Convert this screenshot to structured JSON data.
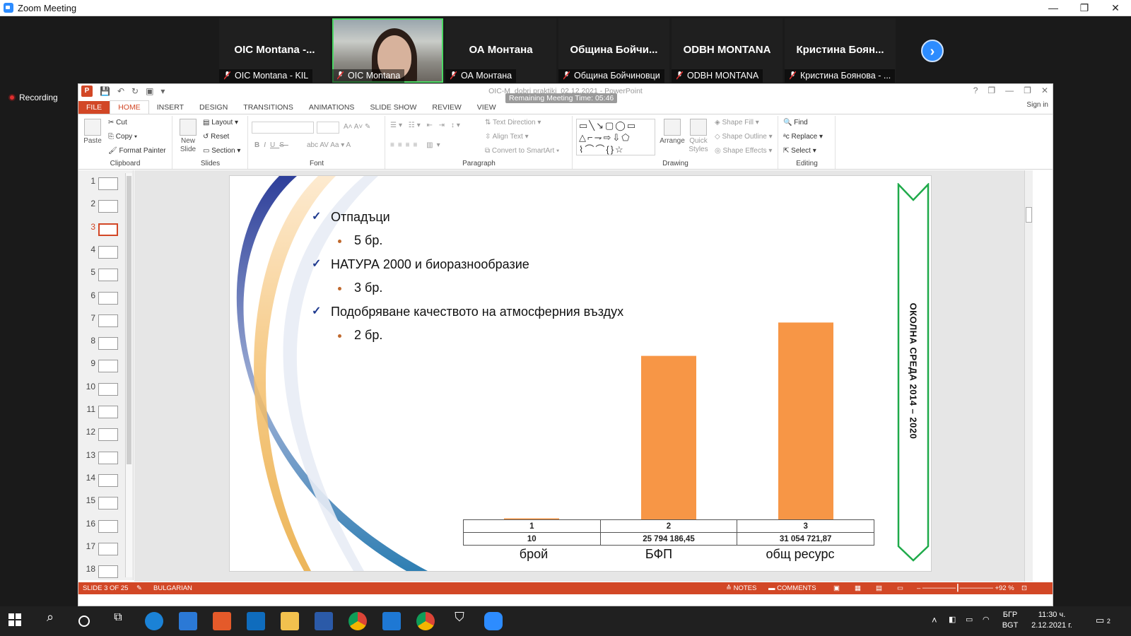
{
  "zoom": {
    "window_title": "Zoom Meeting",
    "win_min": "—",
    "win_restore": "❐",
    "win_close": "✕",
    "recording_label": "Recording",
    "next_arrow": "›",
    "tiles": [
      {
        "big": "OIC Montana -...",
        "name": "OIC Montana - KIL",
        "video": false,
        "active": false
      },
      {
        "big": "",
        "name": "OIC Montana",
        "video": true,
        "active": true
      },
      {
        "big": "ОА Монтана",
        "name": "ОА Монтана",
        "video": false,
        "active": false
      },
      {
        "big": "Община Бойчи...",
        "name": "Община Бойчиновци",
        "video": false,
        "active": false
      },
      {
        "big": "ODBH MONTANA",
        "name": "ODBH MONTANA",
        "video": false,
        "active": false
      },
      {
        "big": "Кристина Боян...",
        "name": "Кристина Боянова - ...",
        "video": false,
        "active": false
      }
    ]
  },
  "ppt": {
    "doc_title": "OIC-M_dobri praktiki_02.12.2021 - PowerPoint",
    "remaining_time": "Remaining Meeting Time: 05:46",
    "help": "?",
    "win_btns": [
      "❐",
      "—",
      "❐",
      "✕"
    ],
    "sign_in": "Sign in",
    "tabs": [
      "FILE",
      "HOME",
      "INSERT",
      "DESIGN",
      "TRANSITIONS",
      "ANIMATIONS",
      "SLIDE SHOW",
      "REVIEW",
      "VIEW"
    ],
    "ribbon": {
      "clipboard": {
        "label": "Clipboard",
        "paste": "Paste",
        "cut": "Cut",
        "copy": "Copy",
        "format_painter": "Format Painter"
      },
      "slides": {
        "label": "Slides",
        "new_slide": "New Slide",
        "layout": "Layout",
        "reset": "Reset",
        "section": "Section"
      },
      "font": {
        "label": "Font",
        "bold": "B",
        "italic": "I",
        "underline": "U",
        "strike": "S",
        "shadow": "abc",
        "spacing": "AV",
        "case": "Aa",
        "color": "A"
      },
      "paragraph": {
        "label": "Paragraph",
        "text_direction": "Text Direction",
        "align_text": "Align Text",
        "convert": "Convert to SmartArt"
      },
      "drawing": {
        "label": "Drawing",
        "arrange": "Arrange",
        "quick_styles": "Quick Styles",
        "shape_fill": "Shape Fill",
        "shape_outline": "Shape Outline",
        "shape_effects": "Shape Effects"
      },
      "editing": {
        "label": "Editing",
        "find": "Find",
        "replace": "Replace",
        "select": "Select"
      }
    },
    "thumbnails": [
      "1",
      "2",
      "3",
      "4",
      "5",
      "6",
      "7",
      "8",
      "9",
      "10",
      "11",
      "12",
      "13",
      "14",
      "15",
      "16",
      "17",
      "18"
    ],
    "selected_slide": 3,
    "status": {
      "slide_of": "SLIDE 3 OF 25",
      "language": "BULGARIAN",
      "notes": "NOTES",
      "comments": "COMMENTS",
      "zoom": "92 %"
    }
  },
  "slide": {
    "bullets": [
      {
        "heading": "Отпадъци",
        "sub": "5 бр."
      },
      {
        "heading": "НАТУРА 2000 и биоразнообразие",
        "sub": "3 бр."
      },
      {
        "heading": "Подобряване качеството на атмосферния въздух",
        "sub": "2 бр."
      }
    ],
    "banner_text": "ОКОЛНА СРЕДА 2014 – 2020",
    "check_mark": "✓"
  },
  "chart_data": {
    "type": "bar",
    "categories": [
      "брой",
      "БФП",
      "общ ресурс"
    ],
    "table_row1": [
      "1",
      "2",
      "3"
    ],
    "table_row2": [
      "10",
      "25 794 186,45",
      "31 054 721,87"
    ],
    "values": [
      10,
      25794186.45,
      31054721.87
    ],
    "color": "#f79646",
    "grid": false,
    "legend": "none"
  },
  "taskbar": {
    "lang1": "БГР",
    "lang2": "BGT",
    "time": "11:30 ч.",
    "date": "2.12.2021 г.",
    "notif": "2"
  }
}
